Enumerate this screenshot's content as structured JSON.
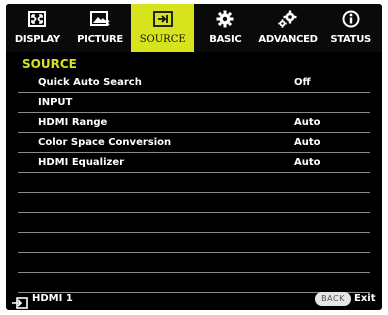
{
  "tabs": [
    {
      "label": "DISPLAY",
      "icon": "display-icon",
      "active": false
    },
    {
      "label": "PICTURE",
      "icon": "picture-icon",
      "active": false
    },
    {
      "label": "SOURCE",
      "icon": "source-icon",
      "active": true
    },
    {
      "label": "BASIC",
      "icon": "gear-icon",
      "active": false
    },
    {
      "label": "ADVANCED",
      "icon": "advanced-gear-icon",
      "active": false
    },
    {
      "label": "STATUS",
      "icon": "info-icon",
      "active": false
    }
  ],
  "section_title": "SOURCE",
  "rows": [
    {
      "name": "Quick Auto Search",
      "value": "Off"
    },
    {
      "name": "INPUT",
      "value": ""
    },
    {
      "name": "HDMI Range",
      "value": "Auto"
    },
    {
      "name": "Color Space Conversion",
      "value": "Auto"
    },
    {
      "name": "HDMI Equalizer",
      "value": "Auto"
    },
    {
      "name": "",
      "value": ""
    },
    {
      "name": "",
      "value": ""
    },
    {
      "name": "",
      "value": ""
    },
    {
      "name": "",
      "value": ""
    },
    {
      "name": "",
      "value": ""
    },
    {
      "name": "",
      "value": ""
    }
  ],
  "footer": {
    "source_icon": "input-source-icon",
    "source_label": "HDMI 1",
    "back_label": "BACK",
    "exit_label": "Exit"
  },
  "colors": {
    "accent": "#d7e31c",
    "background": "#000000",
    "divider": "#8a8a8a"
  }
}
